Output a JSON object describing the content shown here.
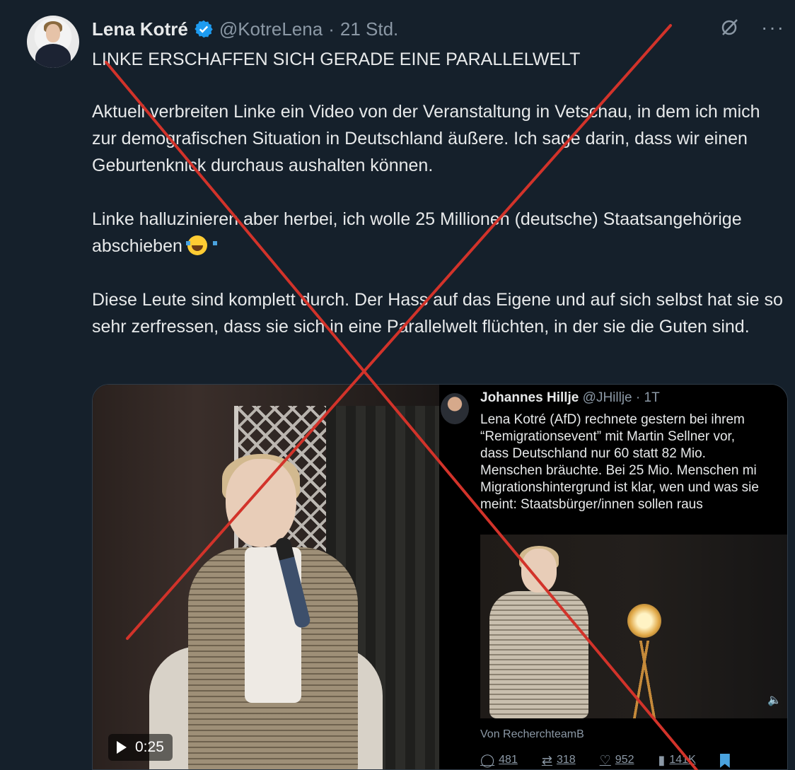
{
  "tweet": {
    "author_name": "Lena Kotré",
    "handle": "@KotreLena",
    "separator": "·",
    "time": "21 Std.",
    "headline": "LINKE ERSCHAFFEN SICH GERADE EINE PARALLELWELT",
    "paragraph_1": "Aktuell verbreiten Linke ein Video von der Veranstaltung in Vetschau, in dem ich mich zur demografischen Situation in Deutschland äußere. Ich sage darin, dass wir einen Geburtenknick durchaus aushalten können.",
    "paragraph_2": "Linke halluzinieren aber herbei, ich wolle 25 Millionen (deutsche) Staatsangehörige abschieben",
    "paragraph_3": "Diese Leute sind komplett durch. Der Hass auf das Eigene und auf sich selbst hat sie so sehr zerfressen, dass sie sich in eine Parallelwelt flüchten, in der sie die Guten sind.",
    "emoji": "face-with-tears-of-joy"
  },
  "video": {
    "duration": "0:25"
  },
  "embedded_tweet": {
    "author_name": "Johannes Hillje",
    "handle": "@JHillje",
    "time": "1T",
    "text": "Lena Kotré (AfD) rechnete gestern bei ihrem\n“Remigrationsevent” mit Martin Sellner vor,\ndass Deutschland nur 60 statt 82 Mio.\nMenschen bräuchte. Bei 25 Mio. Menschen mi\nMigrationshintergrund ist klar, wen und was sie\nmeint: Staatsbürger/innen sollen raus",
    "source": "Von RecherchteamB",
    "replies": "481",
    "reposts": "318",
    "likes": "952",
    "views": "141K"
  },
  "colors": {
    "background": "#15202b",
    "text": "#e7e9ea",
    "muted": "#8b98a5",
    "verified": "#1d9bf0",
    "cross": "#d2332a"
  },
  "icons": [
    "verified-badge-icon",
    "grok-icon",
    "more-icon",
    "play-icon",
    "speaker-icon",
    "reply-icon",
    "repost-icon",
    "like-icon",
    "views-icon",
    "bookmark-icon"
  ]
}
